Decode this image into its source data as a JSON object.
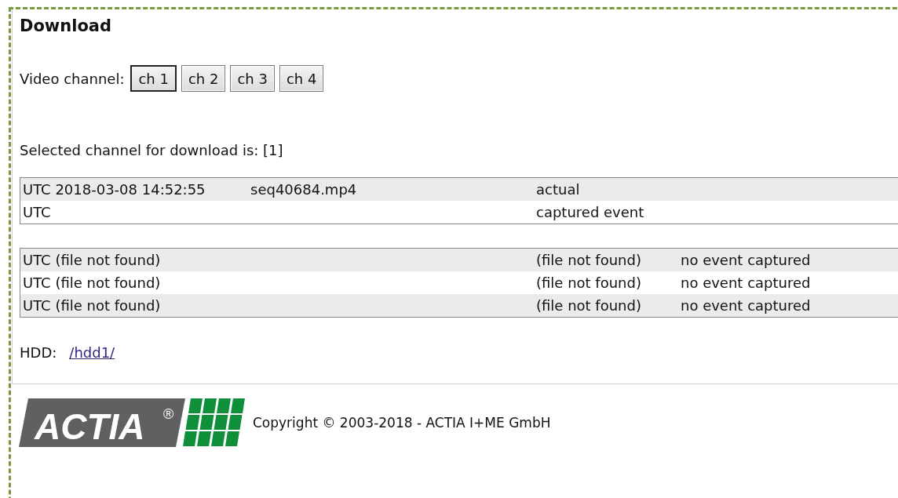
{
  "heading": "Download",
  "channel_picker": {
    "label": "Video channel:",
    "buttons": [
      {
        "label": "ch 1",
        "selected": true
      },
      {
        "label": "ch 2",
        "selected": false
      },
      {
        "label": "ch 3",
        "selected": false
      },
      {
        "label": "ch 4",
        "selected": false
      }
    ]
  },
  "selection_note": "Selected channel for download is: [1]",
  "current_table": {
    "rows": [
      {
        "column_1": "UTC 2018-03-08 14:52:55",
        "column_2": "seq40684.mp4",
        "column_3": "actual"
      },
      {
        "column_1": "UTC",
        "column_3": "captured event"
      }
    ]
  },
  "events_table": {
    "rows": [
      {
        "column_1": "UTC (file not found)",
        "column_3": "(file not found)",
        "column_4": "no event captured"
      },
      {
        "column_1": "UTC (file not found)",
        "column_3": "(file not found)",
        "column_4": "no event captured"
      },
      {
        "column_1": "UTC (file not found)",
        "column_3": "(file not found)",
        "column_4": "no event captured"
      }
    ]
  },
  "hdd": {
    "label": "HDD:",
    "link": "/hdd1/"
  },
  "footer": {
    "logo_text": "ACTIA",
    "logo_mark": "®",
    "copyright": "Copyright © 2003-2018 - ACTIA I+ME GmbH"
  }
}
